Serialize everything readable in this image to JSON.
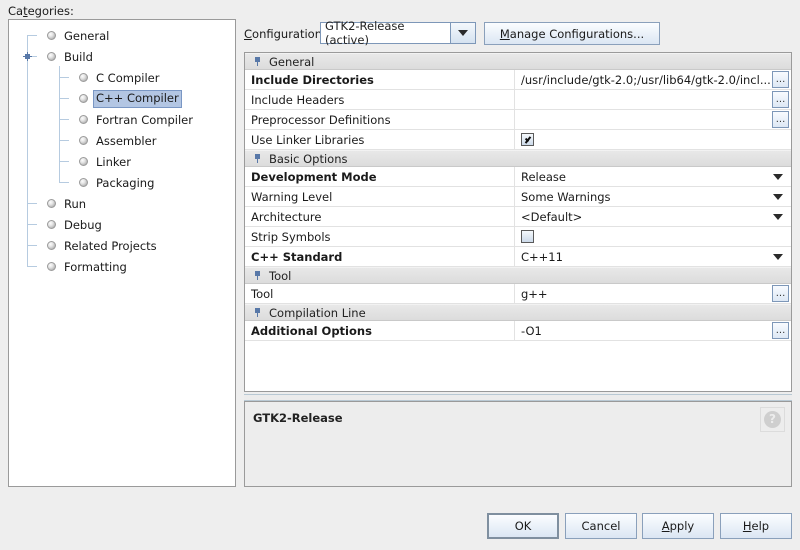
{
  "left_panel": {
    "label": "Categories:",
    "label_mnemonic": "t",
    "tree": [
      {
        "label": "General",
        "level": 0,
        "selected": false
      },
      {
        "label": "Build",
        "level": 0,
        "selected": false,
        "expanded": true
      },
      {
        "label": "C Compiler",
        "level": 1,
        "selected": false
      },
      {
        "label": "C++ Compiler",
        "level": 1,
        "selected": true
      },
      {
        "label": "Fortran Compiler",
        "level": 1,
        "selected": false
      },
      {
        "label": "Assembler",
        "level": 1,
        "selected": false
      },
      {
        "label": "Linker",
        "level": 1,
        "selected": false
      },
      {
        "label": "Packaging",
        "level": 1,
        "selected": false
      },
      {
        "label": "Run",
        "level": 0,
        "selected": false
      },
      {
        "label": "Debug",
        "level": 0,
        "selected": false
      },
      {
        "label": "Related Projects",
        "level": 0,
        "selected": false
      },
      {
        "label": "Formatting",
        "level": 0,
        "selected": false
      }
    ]
  },
  "config_bar": {
    "label": "Configuration:",
    "label_mnemonic": "C",
    "selected": "GTK2-Release (active)",
    "manage_button": "Manage Configurations...",
    "manage_mnemonic": "M"
  },
  "properties": {
    "rows": [
      {
        "kind": "section",
        "name": "General"
      },
      {
        "kind": "text",
        "name": "Include Directories",
        "bold": true,
        "value": "/usr/include/gtk-2.0;/usr/lib64/gtk-2.0/incl...",
        "editor": "ellipsis"
      },
      {
        "kind": "text",
        "name": "Include Headers",
        "bold": false,
        "value": "",
        "editor": "ellipsis"
      },
      {
        "kind": "text",
        "name": "Preprocessor Definitions",
        "bold": false,
        "value": "",
        "editor": "ellipsis"
      },
      {
        "kind": "checkbox",
        "name": "Use Linker Libraries",
        "bold": false,
        "checked": true
      },
      {
        "kind": "section",
        "name": "Basic Options"
      },
      {
        "kind": "combo",
        "name": "Development Mode",
        "bold": true,
        "value": "Release"
      },
      {
        "kind": "combo",
        "name": "Warning Level",
        "bold": false,
        "value": "Some Warnings"
      },
      {
        "kind": "combo",
        "name": "Architecture",
        "bold": false,
        "value": "<Default>"
      },
      {
        "kind": "checkbox",
        "name": "Strip Symbols",
        "bold": false,
        "checked": false
      },
      {
        "kind": "combo",
        "name": "C++ Standard",
        "bold": true,
        "value": "C++11"
      },
      {
        "kind": "section",
        "name": "Tool"
      },
      {
        "kind": "text",
        "name": "Tool",
        "bold": false,
        "value": "g++",
        "editor": "ellipsis"
      },
      {
        "kind": "section",
        "name": "Compilation Line"
      },
      {
        "kind": "text",
        "name": "Additional Options",
        "bold": true,
        "value": "-O1",
        "editor": "ellipsis"
      }
    ],
    "ellipsis_label": "..."
  },
  "description": {
    "title": "GTK2-Release",
    "help_glyph": "?"
  },
  "buttons": {
    "ok": "OK",
    "cancel": "Cancel",
    "apply": "Apply",
    "apply_mnemonic": "A",
    "help": "Help",
    "help_mnemonic": "H"
  },
  "colors": {
    "selection": "#b3c6e3",
    "tree_line": "#b6cbe0",
    "handle": "#5878a8",
    "window_bg": "#eeeeee",
    "section_bg": "#e2e2e2"
  }
}
